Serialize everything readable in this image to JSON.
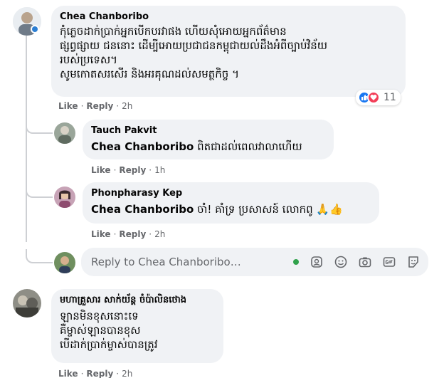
{
  "comments": [
    {
      "author": "Chea Chanboribo",
      "text": "កុំភ្លេចដាក់ប្រាក់អ្នកបើកបរវាផង ហើយសុំអោយអ្នកព័ត៌មាន\nផ្សព្វផ្សាយ ជននោះ ដើម្បីអោយប្រជាជនកម្ពុជាយល់ដឹងអំពីច្បាប់វិន័យ\nរបស់ប្រទេស។\nសូមកោតសរសើរ និងអរគុណដល់សមត្ថកិច្ច ។",
      "like": "Like",
      "reply": "Reply",
      "time": "2h",
      "reaction_count": "11"
    },
    {
      "author": "Tauch Pakvit",
      "mention": "Chea Chanboribo",
      "text": " ពិតជាដល់ពេលវាលាហើយ",
      "like": "Like",
      "reply": "Reply",
      "time": "1h"
    },
    {
      "author": "Phonpharasy Kep",
      "mention": "Chea Chanboribo",
      "text": " ចាំ! គាំទ្រ ប្រសាសន៍ លោកពូ 🙏👍",
      "like": "Like",
      "reply": "Reply",
      "time": "2h"
    },
    {
      "author": "មហាគ្រួសារ សាក់យ័ន្ត ចំប៉ាលិនថោង",
      "text": "ឡានមិនខុសនោះទេ\nគឺម្ចាស់ឡានបានខុស\nបើដាក់ប្រាក់ម្ចាស់បានត្រូវ",
      "like": "Like",
      "reply": "Reply",
      "time": "2h"
    }
  ],
  "reply_box": {
    "placeholder": "Reply to Chea Chanboribo…"
  },
  "colors": {
    "bubble": "#f0f2f5",
    "meta": "#65676b",
    "like_blue": "#1877f2",
    "love_red": "#f33e58",
    "online_green": "#31a24c"
  },
  "icons": [
    "like-reaction-icon",
    "love-reaction-icon",
    "online-dot",
    "emoji-icon",
    "camera-icon",
    "gif-icon",
    "sticker-icon",
    "avatar-icon"
  ]
}
